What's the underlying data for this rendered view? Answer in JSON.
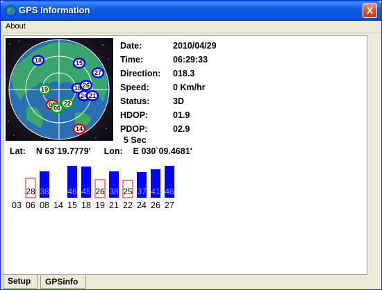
{
  "window": {
    "title": "GPS Information",
    "close_label": "X",
    "title_icon": "globe-icon"
  },
  "menu": {
    "items": [
      {
        "label": "About"
      }
    ]
  },
  "info": {
    "rows": [
      {
        "label": "Date:",
        "value": "2010/04/29"
      },
      {
        "label": "Time:",
        "value": "06:29:33"
      },
      {
        "label": "Direction:",
        "value": "018.3"
      },
      {
        "label": "Speed:",
        "value": "0 Km/hr"
      },
      {
        "label": "Status:",
        "value": "3D"
      },
      {
        "label": "HDOP:",
        "value": "01.9"
      },
      {
        "label": "PDOP:",
        "value": "02.9"
      }
    ],
    "update_interval": "5 Sec",
    "lat_label": "Lat:",
    "lat_value": "N  63`19.7779'",
    "lon_label": "Lon:",
    "lon_value": "E  030`09.4681'"
  },
  "skyplot": {
    "satellites": [
      {
        "id": "18",
        "used": true
      },
      {
        "id": "15",
        "used": true
      },
      {
        "id": "27",
        "used": true
      },
      {
        "id": "19",
        "used": false
      },
      {
        "id": "18",
        "used": true
      },
      {
        "id": "26",
        "used": true
      },
      {
        "id": "24",
        "used": true
      },
      {
        "id": "21",
        "used": true
      },
      {
        "id": "06",
        "used": false
      },
      {
        "id": "22",
        "used": false
      },
      {
        "id": "06",
        "used": false
      },
      {
        "id": "14",
        "used": false
      }
    ]
  },
  "satellites": {
    "ids": [
      "03",
      "06",
      "08",
      "14",
      "15",
      "18",
      "19",
      "21",
      "22",
      "24",
      "26",
      "27"
    ],
    "snr": [
      0,
      28,
      38,
      0,
      46,
      45,
      26,
      38,
      25,
      37,
      41,
      46
    ],
    "used": [
      false,
      false,
      true,
      false,
      true,
      true,
      false,
      true,
      false,
      true,
      true,
      true
    ],
    "colors": {
      "used": "#0000ff",
      "unused": "#ff0000",
      "label": "#000000"
    }
  },
  "tabs": [
    {
      "label": "Setup"
    },
    {
      "label": "GPSinfo"
    }
  ],
  "colors": {
    "titlebar": "#0753d8",
    "earth_green": "#3aa66a",
    "earth_blue": "#2a6fb0"
  }
}
